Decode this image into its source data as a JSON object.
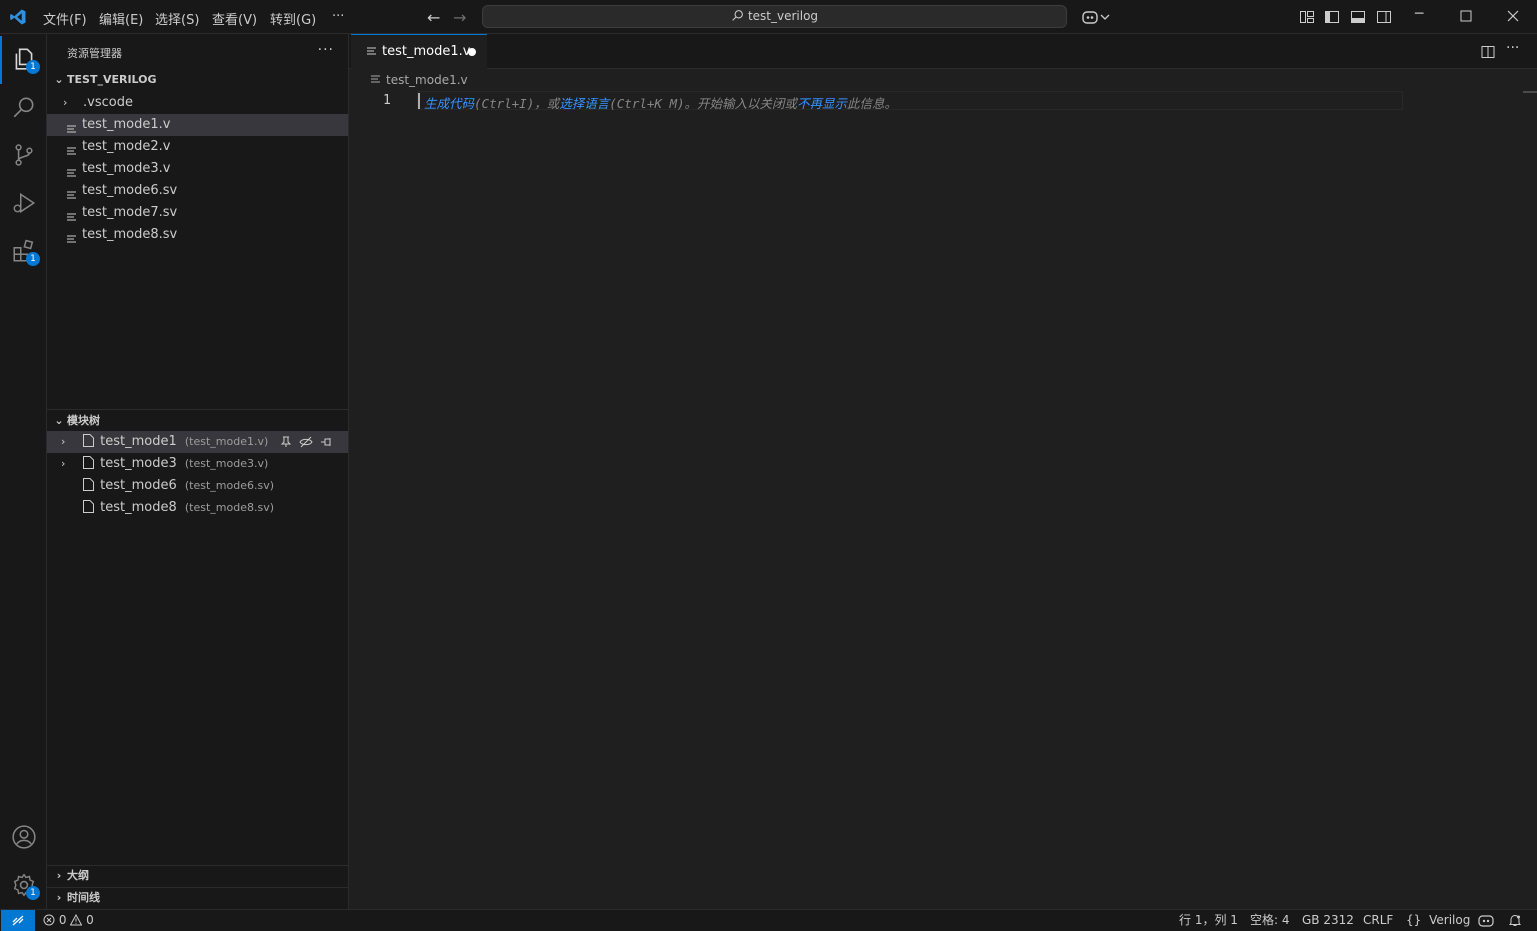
{
  "titlebar": {
    "menus": [
      "文件(F)",
      "编辑(E)",
      "选择(S)",
      "查看(V)",
      "转到(G)",
      "···"
    ],
    "search_text": "test_verilog"
  },
  "activity_bar": {
    "explorer_badge": "1",
    "extensions_badge": "1",
    "settings_badge": "1"
  },
  "explorer": {
    "title": "资源管理器",
    "more": "···",
    "folder": "TEST_VERILOG",
    "items": [
      ".vscode",
      "test_mode1.v",
      "test_mode2.v",
      "test_mode3.v",
      "test_mode6.sv",
      "test_mode7.sv",
      "test_mode8.sv"
    ],
    "selected": "test_mode1.v"
  },
  "module_tree": {
    "title": "模块树",
    "items": [
      {
        "name": "test_mode1",
        "file": "(test_mode1.v)",
        "expandable": true
      },
      {
        "name": "test_mode3",
        "file": "(test_mode3.v)",
        "expandable": true
      },
      {
        "name": "test_mode6",
        "file": "(test_mode6.sv)",
        "expandable": false
      },
      {
        "name": "test_mode8",
        "file": "(test_mode8.sv)",
        "expandable": false
      }
    ]
  },
  "bottom_sections": {
    "outline": "大纲",
    "timeline": "时间线"
  },
  "editor": {
    "tab_label": "test_mode1.v",
    "breadcrumb": "test_mode1.v",
    "line_number": "1",
    "hint": {
      "generate_link": "生成代码",
      "part1": "(Ctrl+I)，或",
      "language_link": "选择语言",
      "part2": "(Ctrl+K M)。开始输入以关闭或",
      "dismiss_link": "不再显示",
      "part3": "此信息。"
    }
  },
  "statusbar": {
    "errors": "0",
    "warnings": "0",
    "position": "行 1，列 1",
    "spaces": "空格: 4",
    "encoding": "GB 2312",
    "eol": "CRLF",
    "language": "Verilog",
    "language_prefix": "{}"
  },
  "colors": {
    "accent": "#0078d4",
    "link": "#3794ff"
  }
}
